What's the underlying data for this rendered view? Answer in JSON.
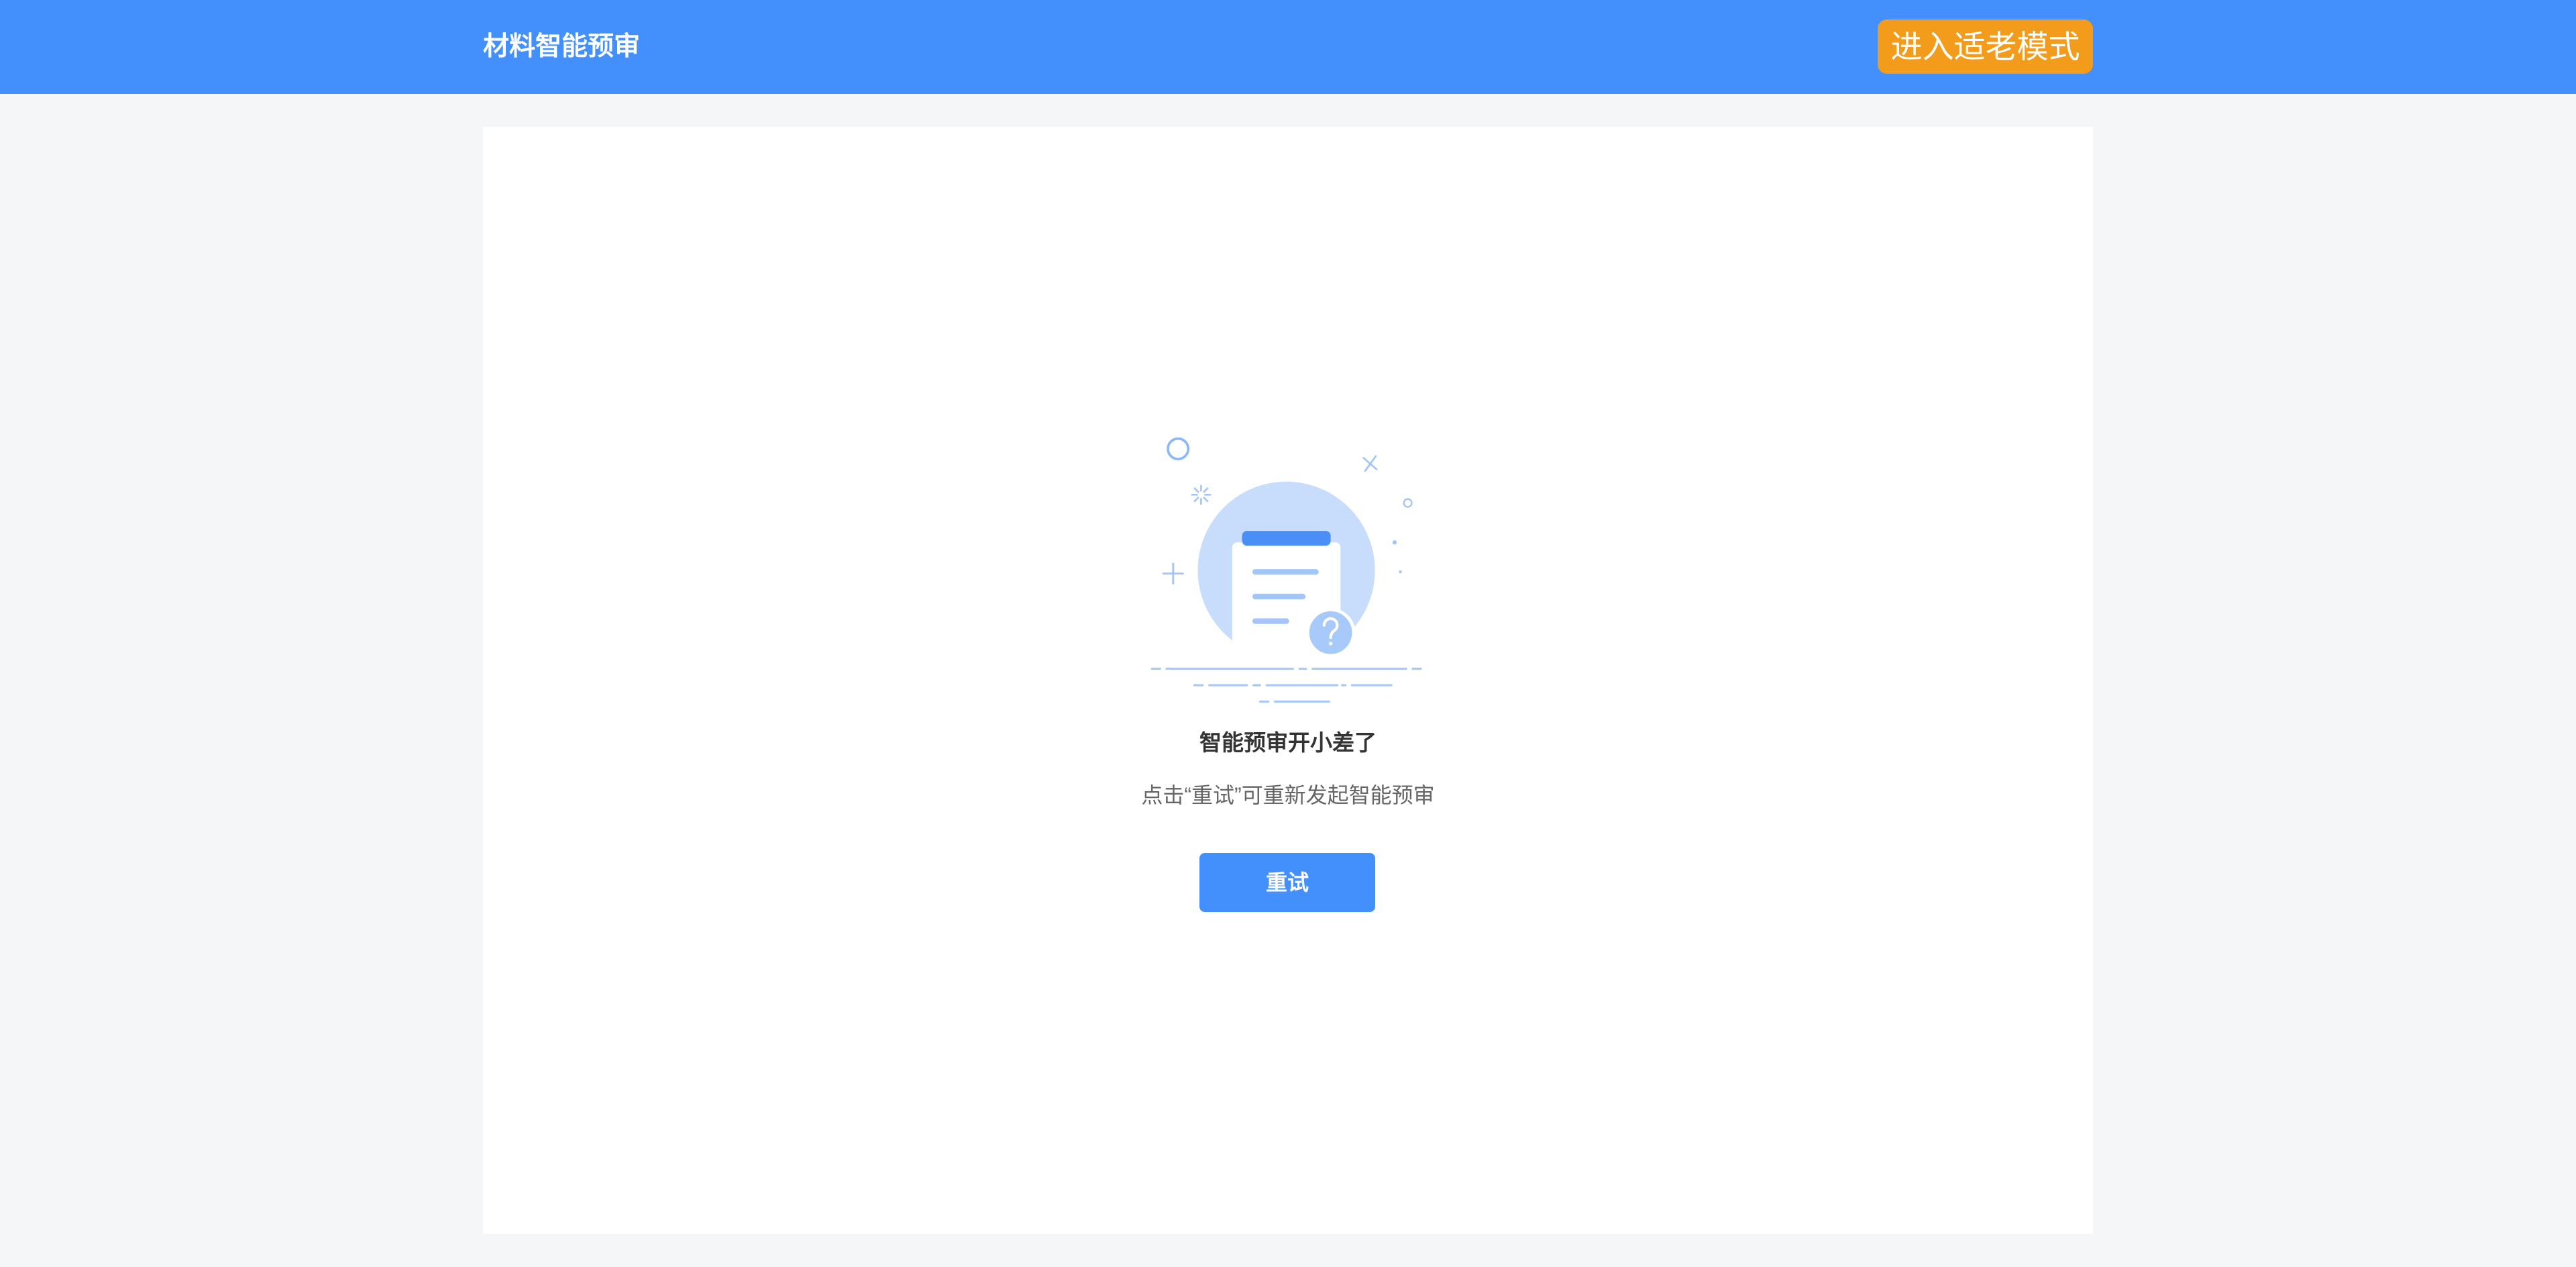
{
  "header": {
    "title": "材料智能预审",
    "elder_mode_label": "进入适老模式"
  },
  "status": {
    "illustration_icon": "document-question-icon",
    "title": "智能预审开小差了",
    "description": "点击“重试”可重新发起智能预审",
    "retry_label": "重试"
  },
  "colors": {
    "primary": "#4390FD",
    "accent": "#F39B1B",
    "background": "#F5F6F8",
    "illustration_light": "#C8DDFB",
    "illustration_line": "#A3C6F9"
  }
}
